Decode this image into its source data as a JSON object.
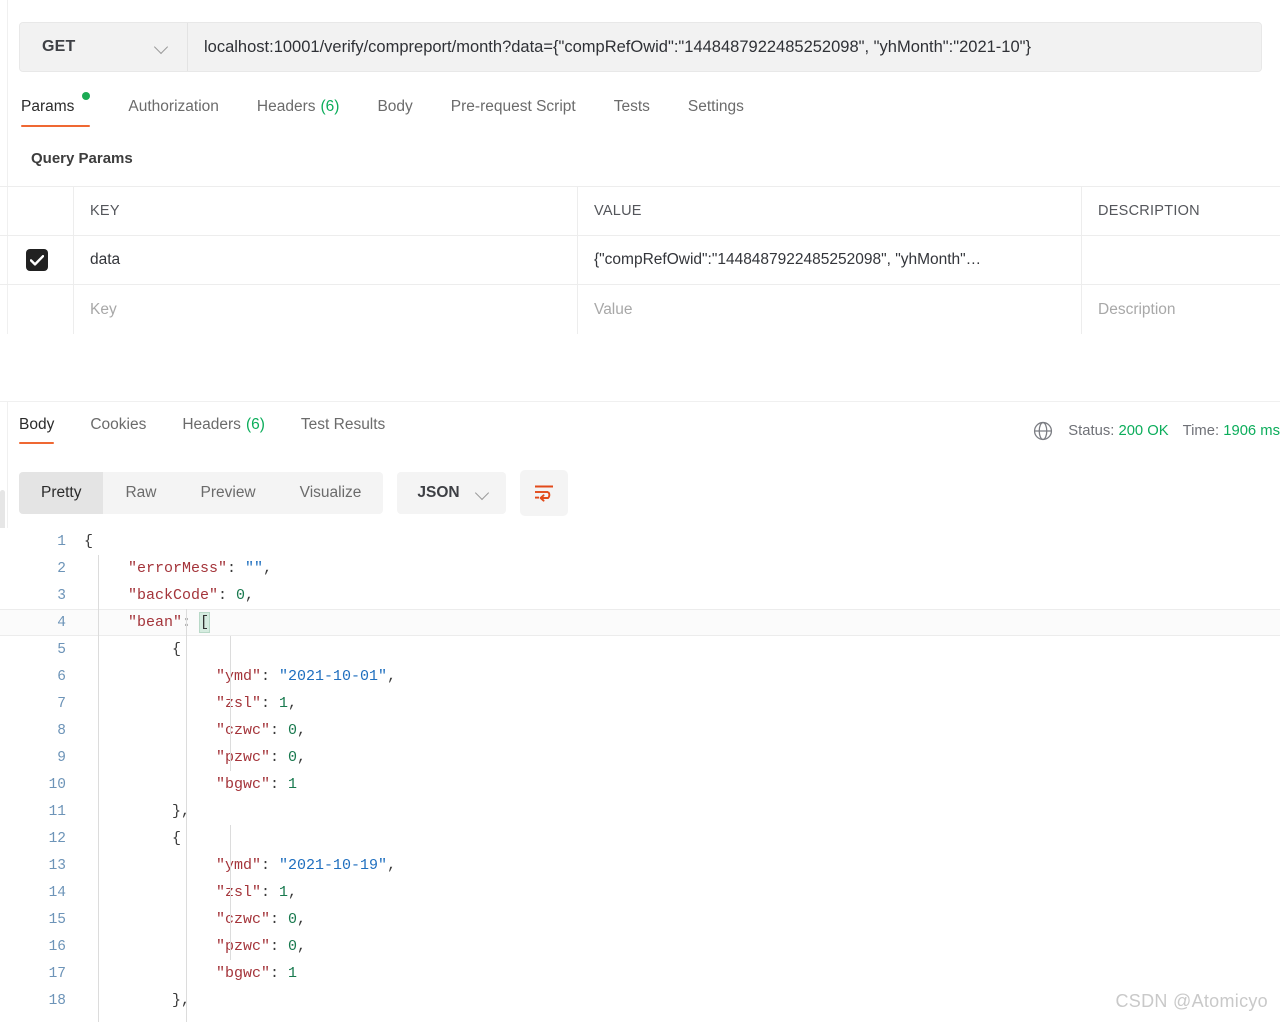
{
  "request": {
    "method": "GET",
    "method_icon": "chevron-down-icon",
    "url": "localhost:10001/verify/compreport/month?data={\"compRefOwid\":\"1448487922485252098\", \"yhMonth\":\"2021-10\"}",
    "tabs": [
      {
        "label": "Params",
        "badge_dot": true,
        "active": true
      },
      {
        "label": "Authorization",
        "active": false
      },
      {
        "label": "Headers",
        "count": "(6)",
        "active": false
      },
      {
        "label": "Body",
        "active": false
      },
      {
        "label": "Pre-request Script",
        "active": false
      },
      {
        "label": "Tests",
        "active": false
      },
      {
        "label": "Settings",
        "active": false
      }
    ]
  },
  "query_params": {
    "title": "Query Params",
    "columns": [
      "KEY",
      "VALUE",
      "DESCRIPTION"
    ],
    "rows": [
      {
        "checked": true,
        "key": "data",
        "value": "{\"compRefOwid\":\"1448487922485252098\", \"yhMonth\"…",
        "description": ""
      }
    ],
    "placeholder_row": {
      "key": "Key",
      "value": "Value",
      "description": "Description"
    }
  },
  "response": {
    "tabs": [
      {
        "label": "Body",
        "active": true
      },
      {
        "label": "Cookies",
        "active": false
      },
      {
        "label": "Headers",
        "count": "(6)",
        "active": false
      },
      {
        "label": "Test Results",
        "active": false
      }
    ],
    "globe_icon": "globe-icon",
    "status_label": "Status:",
    "status_value": "200 OK",
    "time_label": "Time:",
    "time_value": "1906 ms",
    "view_modes": [
      {
        "label": "Pretty",
        "active": true
      },
      {
        "label": "Raw",
        "active": false
      },
      {
        "label": "Preview",
        "active": false
      },
      {
        "label": "Visualize",
        "active": false
      }
    ],
    "language": "JSON",
    "language_icon": "chevron-down-icon",
    "wrap_button_icon": "word-wrap-icon"
  },
  "code": {
    "lines": [
      {
        "n": "1",
        "indent": 0,
        "tokens": [
          {
            "t": "{",
            "c": "brace"
          }
        ]
      },
      {
        "n": "2",
        "indent": 1,
        "tokens": [
          {
            "t": "\"errorMess\"",
            "c": "key"
          },
          {
            "t": ": ",
            "c": "punct"
          },
          {
            "t": "\"\"",
            "c": "str"
          },
          {
            "t": ",",
            "c": "punct"
          }
        ]
      },
      {
        "n": "3",
        "indent": 1,
        "tokens": [
          {
            "t": "\"backCode\"",
            "c": "key"
          },
          {
            "t": ": ",
            "c": "punct"
          },
          {
            "t": "0",
            "c": "num"
          },
          {
            "t": ",",
            "c": "punct"
          }
        ]
      },
      {
        "n": "4",
        "indent": 1,
        "active": true,
        "tokens": [
          {
            "t": "\"bean\"",
            "c": "key"
          },
          {
            "t": ": ",
            "c": "punct"
          },
          {
            "t": "[",
            "c": "hl"
          }
        ]
      },
      {
        "n": "5",
        "indent": 2,
        "tokens": [
          {
            "t": "{",
            "c": "brace"
          }
        ]
      },
      {
        "n": "6",
        "indent": 3,
        "tokens": [
          {
            "t": "\"ymd\"",
            "c": "key"
          },
          {
            "t": ": ",
            "c": "punct"
          },
          {
            "t": "\"2021-10-01\"",
            "c": "str"
          },
          {
            "t": ",",
            "c": "punct"
          }
        ]
      },
      {
        "n": "7",
        "indent": 3,
        "tokens": [
          {
            "t": "\"zsl\"",
            "c": "key"
          },
          {
            "t": ": ",
            "c": "punct"
          },
          {
            "t": "1",
            "c": "num"
          },
          {
            "t": ",",
            "c": "punct"
          }
        ]
      },
      {
        "n": "8",
        "indent": 3,
        "tokens": [
          {
            "t": "\"czwc\"",
            "c": "key"
          },
          {
            "t": ": ",
            "c": "punct"
          },
          {
            "t": "0",
            "c": "num"
          },
          {
            "t": ",",
            "c": "punct"
          }
        ]
      },
      {
        "n": "9",
        "indent": 3,
        "tokens": [
          {
            "t": "\"pzwc\"",
            "c": "key"
          },
          {
            "t": ": ",
            "c": "punct"
          },
          {
            "t": "0",
            "c": "num"
          },
          {
            "t": ",",
            "c": "punct"
          }
        ]
      },
      {
        "n": "10",
        "indent": 3,
        "tokens": [
          {
            "t": "\"bgwc\"",
            "c": "key"
          },
          {
            "t": ": ",
            "c": "punct"
          },
          {
            "t": "1",
            "c": "num"
          }
        ]
      },
      {
        "n": "11",
        "indent": 2,
        "tokens": [
          {
            "t": "}",
            "c": "brace"
          },
          {
            "t": ",",
            "c": "punct"
          }
        ]
      },
      {
        "n": "12",
        "indent": 2,
        "tokens": [
          {
            "t": "{",
            "c": "brace"
          }
        ]
      },
      {
        "n": "13",
        "indent": 3,
        "tokens": [
          {
            "t": "\"ymd\"",
            "c": "key"
          },
          {
            "t": ": ",
            "c": "punct"
          },
          {
            "t": "\"2021-10-19\"",
            "c": "str"
          },
          {
            "t": ",",
            "c": "punct"
          }
        ]
      },
      {
        "n": "14",
        "indent": 3,
        "tokens": [
          {
            "t": "\"zsl\"",
            "c": "key"
          },
          {
            "t": ": ",
            "c": "punct"
          },
          {
            "t": "1",
            "c": "num"
          },
          {
            "t": ",",
            "c": "punct"
          }
        ]
      },
      {
        "n": "15",
        "indent": 3,
        "tokens": [
          {
            "t": "\"czwc\"",
            "c": "key"
          },
          {
            "t": ": ",
            "c": "punct"
          },
          {
            "t": "0",
            "c": "num"
          },
          {
            "t": ",",
            "c": "punct"
          }
        ]
      },
      {
        "n": "16",
        "indent": 3,
        "tokens": [
          {
            "t": "\"pzwc\"",
            "c": "key"
          },
          {
            "t": ": ",
            "c": "punct"
          },
          {
            "t": "0",
            "c": "num"
          },
          {
            "t": ",",
            "c": "punct"
          }
        ]
      },
      {
        "n": "17",
        "indent": 3,
        "tokens": [
          {
            "t": "\"bgwc\"",
            "c": "key"
          },
          {
            "t": ": ",
            "c": "punct"
          },
          {
            "t": "1",
            "c": "num"
          }
        ]
      },
      {
        "n": "18",
        "indent": 2,
        "tokens": [
          {
            "t": "}",
            "c": "brace"
          },
          {
            "t": ",",
            "c": "punct"
          }
        ]
      }
    ]
  },
  "watermark": "CSDN @Atomicyo",
  "colors": {
    "accent": "#ef6833",
    "status_green": "#0cad5b",
    "dot_green": "#1bab54",
    "key_red": "#a4343a",
    "string_blue": "#1f6fbf",
    "number_green": "#18794e",
    "linenum_blue": "#6d94b8"
  }
}
